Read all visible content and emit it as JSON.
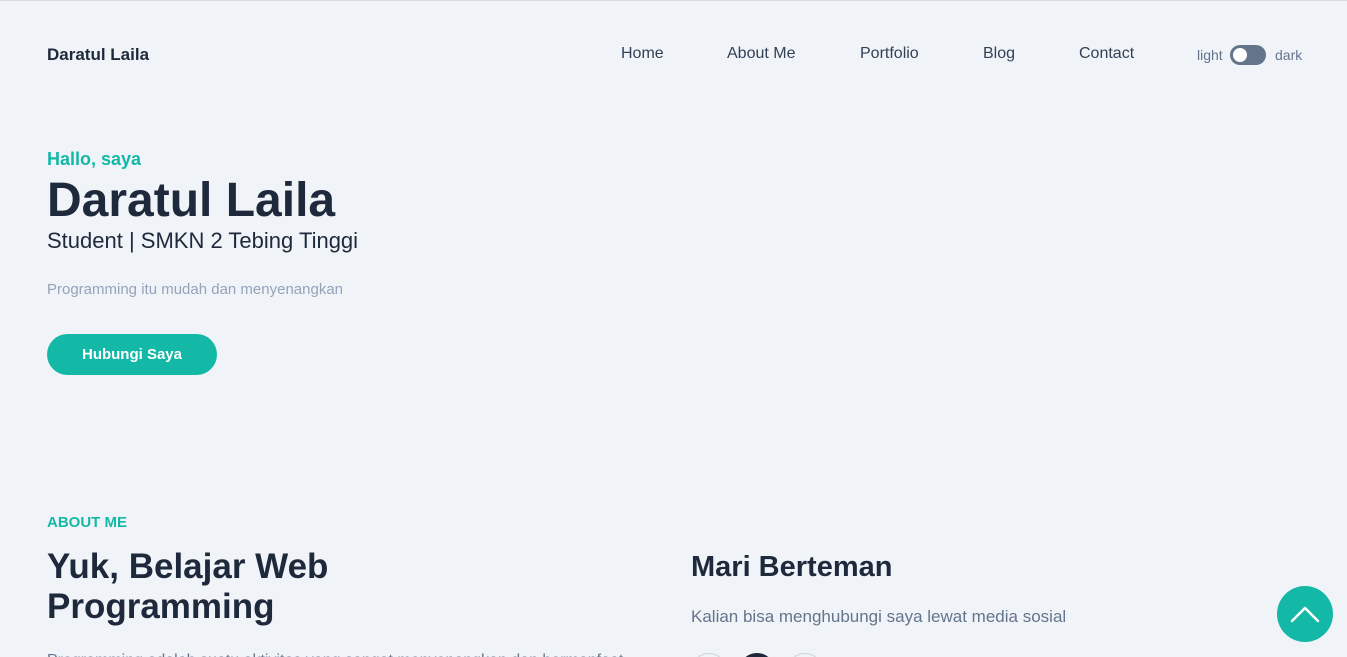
{
  "header": {
    "brand": "Daratul Laila",
    "nav": [
      "Home",
      "About Me",
      "Portfolio",
      "Blog",
      "Contact"
    ],
    "theme_toggle": {
      "light_label": "light",
      "dark_label": "dark",
      "state": "light"
    }
  },
  "hero": {
    "greeting": "Hallo, saya",
    "name": "Daratul Laila",
    "role": "Student | SMKN 2 Tebing Tinggi",
    "tagline": "Programming itu mudah dan menyenangkan",
    "cta_label": "Hubungi Saya"
  },
  "about": {
    "eyebrow": "ABOUT ME",
    "title": "Yuk, Belajar Web Programming",
    "body": "Programming adalah suatu aktivitas yang sangat menyenangkan dan bermanfaat",
    "friends_title": "Mari Berteman",
    "friends_text": "Kalian bisa menghubungi saya lewat media sosial"
  },
  "colors": {
    "accent": "#14b8a6",
    "background": "#f0f4f9",
    "heading": "#1e293b",
    "muted": "#94a3b8"
  },
  "icons": {
    "back_to_top": "chevron-up-icon",
    "socials": [
      "social-icon",
      "social-icon",
      "social-icon"
    ]
  }
}
